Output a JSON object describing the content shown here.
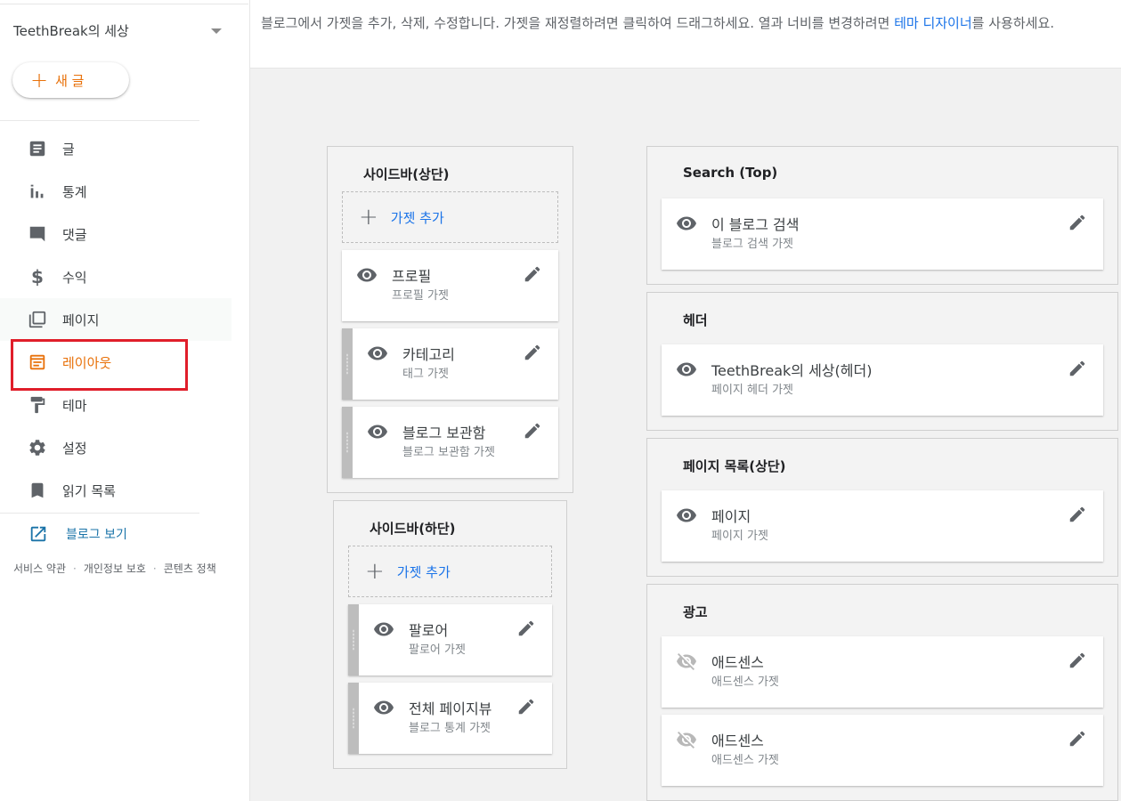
{
  "sidebar": {
    "blog_name": "TeethBreak의 세상",
    "new_post_label": "새 글",
    "items": [
      {
        "label": "글",
        "icon": "posts-icon"
      },
      {
        "label": "통계",
        "icon": "stats-icon"
      },
      {
        "label": "댓글",
        "icon": "comments-icon"
      },
      {
        "label": "수익",
        "icon": "earnings-icon"
      },
      {
        "label": "페이지",
        "icon": "pages-icon"
      },
      {
        "label": "레이아웃",
        "icon": "layout-icon",
        "active": true
      },
      {
        "label": "테마",
        "icon": "theme-icon"
      },
      {
        "label": "설정",
        "icon": "settings-icon"
      },
      {
        "label": "읽기 목록",
        "icon": "reading-list-icon"
      }
    ],
    "view_blog_label": "블로그 보기",
    "footer": [
      "서비스 약관",
      "개인정보 보호",
      "콘텐츠 정책"
    ]
  },
  "info": {
    "text_before": "블로그에서 가젯을 추가, 삭제, 수정합니다. 가젯을 재정렬하려면 클릭하여 드래그하세요. 열과 너비를 변경하려면 ",
    "link": "테마 디자이너",
    "text_after": "를 사용하세요."
  },
  "sections": {
    "sidebar_top": {
      "title": "사이드바(상단)",
      "add_label": "가젯 추가",
      "gadgets": [
        {
          "name": "프로필",
          "type": "프로필 가젯",
          "visible": true
        },
        {
          "name": "카테고리",
          "type": "태그 가젯",
          "visible": true
        },
        {
          "name": "블로그 보관함",
          "type": "블로그 보관함 가젯",
          "visible": true
        }
      ]
    },
    "sidebar_bottom": {
      "title": "사이드바(하단)",
      "add_label": "가젯 추가",
      "gadgets": [
        {
          "name": "팔로어",
          "type": "팔로어 가젯",
          "visible": true
        },
        {
          "name": "전체 페이지뷰",
          "type": "블로그 통계 가젯",
          "visible": true
        }
      ]
    },
    "search_top": {
      "title": "Search (Top)",
      "gadgets": [
        {
          "name": "이 블로그 검색",
          "type": "블로그 검색 가젯",
          "visible": true
        }
      ]
    },
    "header": {
      "title": "헤더",
      "gadgets": [
        {
          "name": "TeethBreak의 세상(헤더)",
          "type": "페이지 헤더 가젯",
          "visible": true
        }
      ]
    },
    "pages_top": {
      "title": "페이지 목록(상단)",
      "gadgets": [
        {
          "name": "페이지",
          "type": "페이지 가젯",
          "visible": true
        }
      ]
    },
    "ads": {
      "title": "광고",
      "gadgets": [
        {
          "name": "애드센스",
          "type": "애드센스 가젯",
          "visible": false
        },
        {
          "name": "애드센스",
          "type": "애드센스 가젯",
          "visible": false
        }
      ]
    }
  },
  "colors": {
    "accent": "#e8710a",
    "link": "#1a73e8",
    "highlight_box": "#e01e2a"
  }
}
